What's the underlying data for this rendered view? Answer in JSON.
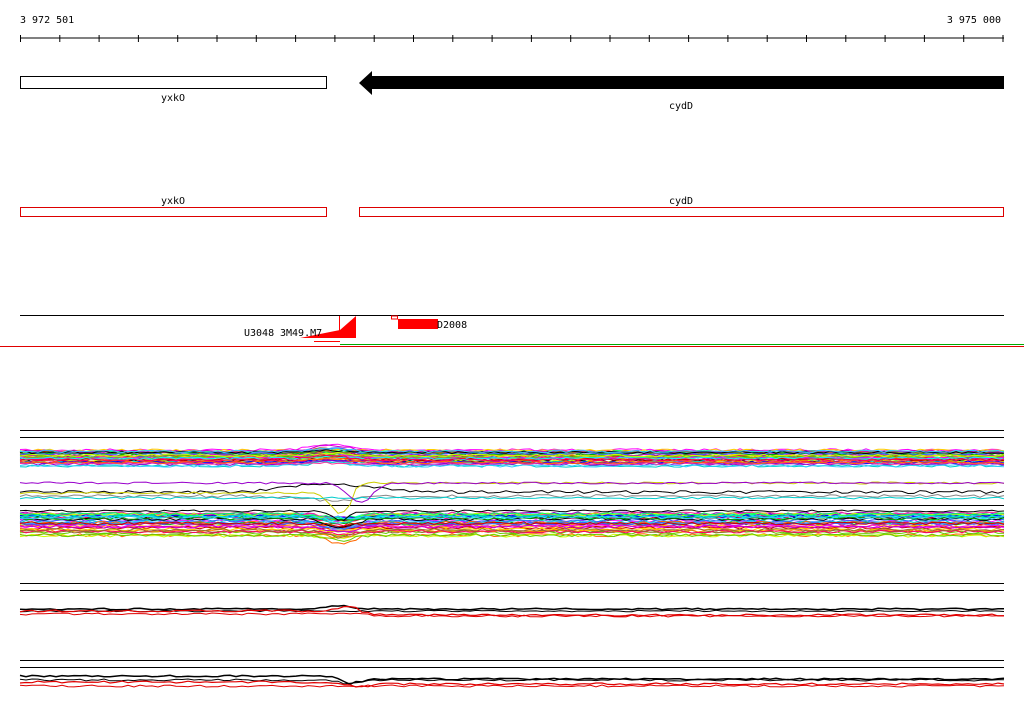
{
  "ruler": {
    "start_label": "3 972 501",
    "end_label": "3 975 000"
  },
  "genes": [
    {
      "name": "yxkO",
      "strand": "forward",
      "style": "outline"
    },
    {
      "name": "cydD",
      "strand": "reverse",
      "style": "filled"
    }
  ],
  "gene_track_labels": {
    "left": "yxkO",
    "right": "cydD"
  },
  "features": {
    "left_label": "U3048",
    "overlap_label": "3M49.M7",
    "right_label": "D2008"
  },
  "colors": {
    "gene_outline": "#000000",
    "gene_fill": "#000000",
    "annotation_box": "#dd0000",
    "feature": "#ff0000",
    "divider_red": "#e00000",
    "divider_green": "#00aa00"
  }
}
